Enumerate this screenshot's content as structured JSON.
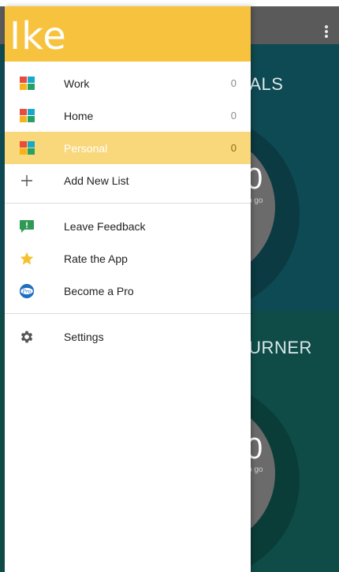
{
  "background": {
    "goals_title": "DALS",
    "goals_count": "0",
    "goals_sub": "o go",
    "burner_title": "BURNER",
    "burner_count": "0",
    "burner_sub": "o go"
  },
  "drawer": {
    "logo": "Ike",
    "lists": [
      {
        "label": "Work",
        "count": "0",
        "icon": "grid-list-icon"
      },
      {
        "label": "Home",
        "count": "0",
        "icon": "grid-list-icon"
      },
      {
        "label": "Personal",
        "count": "0",
        "icon": "grid-list-icon",
        "active": true
      }
    ],
    "add_list": {
      "label": "Add New List",
      "icon": "plus-icon"
    },
    "secondary": [
      {
        "label": "Leave Feedback",
        "icon": "feedback-icon"
      },
      {
        "label": "Rate the App",
        "icon": "star-icon"
      },
      {
        "label": "Become a Pro",
        "icon": "pro-badge-icon",
        "badge_text": "Pro"
      }
    ],
    "settings": {
      "label": "Settings",
      "icon": "gear-icon"
    }
  },
  "colors": {
    "header": "#f7c23e",
    "active_row": "#f9d77b",
    "goals_bg": "#0e4a53",
    "burner_bg": "#0f4c47"
  }
}
